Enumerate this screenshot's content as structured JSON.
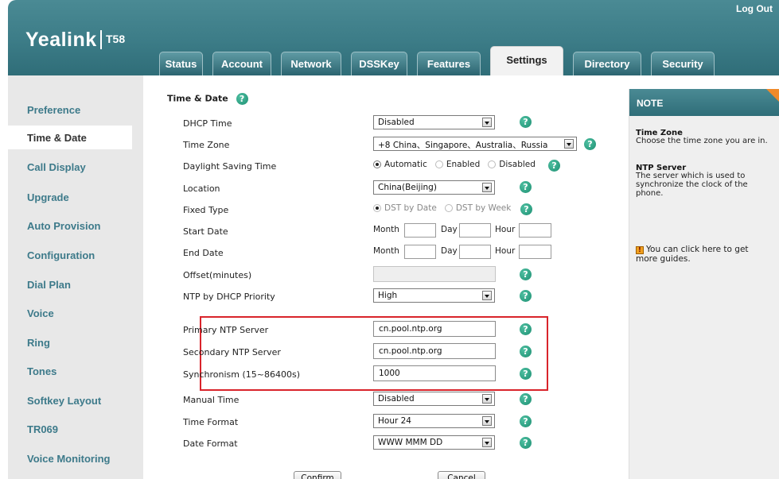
{
  "header": {
    "brand": "Yealink",
    "model": "T58",
    "logout": "Log Out",
    "tabs": [
      "Status",
      "Account",
      "Network",
      "DSSKey",
      "Features",
      "Settings",
      "Directory",
      "Security"
    ],
    "active_tab": "Settings"
  },
  "sidebar": {
    "items": [
      "Preference",
      "Time & Date",
      "Call Display",
      "Upgrade",
      "Auto Provision",
      "Configuration",
      "Dial Plan",
      "Voice",
      "Ring",
      "Tones",
      "Softkey Layout",
      "TR069",
      "Voice Monitoring"
    ],
    "active": "Time & Date"
  },
  "section": {
    "title": "Time & Date",
    "help": "?"
  },
  "fields": {
    "dhcp_time": {
      "label": "DHCP Time",
      "value": "Disabled"
    },
    "time_zone": {
      "label": "Time Zone",
      "value": "+8 China、Singapore、Australia、Russia"
    },
    "daylight_saving": {
      "label": "Daylight Saving Time",
      "options": [
        "Automatic",
        "Enabled",
        "Disabled"
      ],
      "selected": "Automatic"
    },
    "location": {
      "label": "Location",
      "value": "China(Beijing)"
    },
    "fixed_type": {
      "label": "Fixed Type",
      "options": [
        "DST by Date",
        "DST by Week"
      ],
      "selected": "DST by Date"
    },
    "start_date": {
      "label": "Start Date",
      "month": "Month",
      "day": "Day",
      "hour": "Hour"
    },
    "end_date": {
      "label": "End Date",
      "month": "Month",
      "day": "Day",
      "hour": "Hour"
    },
    "offset": {
      "label": "Offset(minutes)",
      "value": ""
    },
    "ntp_priority": {
      "label": "NTP by DHCP Priority",
      "value": "High"
    },
    "primary_ntp": {
      "label": "Primary NTP Server",
      "value": "cn.pool.ntp.org"
    },
    "secondary_ntp": {
      "label": "Secondary NTP Server",
      "value": "cn.pool.ntp.org"
    },
    "sync": {
      "label": "Synchronism (15~86400s)",
      "value": "1000"
    },
    "manual_time": {
      "label": "Manual Time",
      "value": "Disabled"
    },
    "time_format": {
      "label": "Time Format",
      "value": "Hour 24"
    },
    "date_format": {
      "label": "Date Format",
      "value": "WWW MMM DD"
    }
  },
  "buttons": {
    "confirm": "Confirm",
    "cancel": "Cancel"
  },
  "note": {
    "title": "NOTE",
    "tz_heading": "Time Zone",
    "tz_text": "Choose the time zone you are in.",
    "ntp_heading": "NTP Server",
    "ntp_text": "The server which is used to synchronize the clock of the phone.",
    "guide_icon": "!",
    "guide_text": "You can click here to get more guides."
  },
  "colors": {
    "header": "#3c7c87",
    "sidebar_link": "#3d7a8a",
    "highlight": "#d9242b",
    "help_icon": "#1d8f72"
  }
}
